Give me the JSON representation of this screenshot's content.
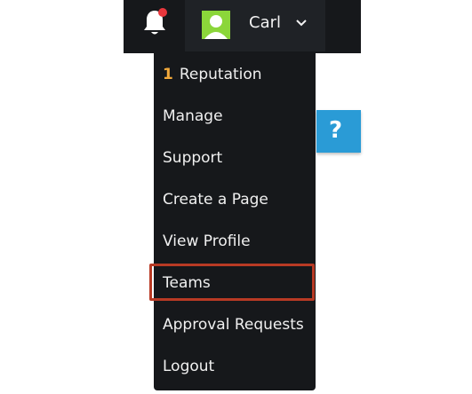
{
  "header": {
    "notification_icon": "bell-icon",
    "notification_dot_color": "#e8373d",
    "user": {
      "name": "Carl",
      "avatar_icon": "user-avatar-icon",
      "dropdown_icon": "chevron-down-icon"
    }
  },
  "help": {
    "label": "?",
    "color": "#2a9bd6"
  },
  "menu": {
    "reputation": {
      "count": "1",
      "label": "Reputation"
    },
    "items": [
      {
        "label": "Manage"
      },
      {
        "label": "Support"
      },
      {
        "label": "Create a Page"
      },
      {
        "label": "View Profile"
      },
      {
        "label": "Teams",
        "highlighted": true
      },
      {
        "label": "Approval Requests"
      },
      {
        "label": "Logout"
      }
    ]
  },
  "colors": {
    "topbar_bg": "#16181b",
    "menu_bg": "#16181b",
    "highlight_border": "#b83a24",
    "reputation_accent": "#f2a93b",
    "avatar_bg": "#8bd63a"
  }
}
